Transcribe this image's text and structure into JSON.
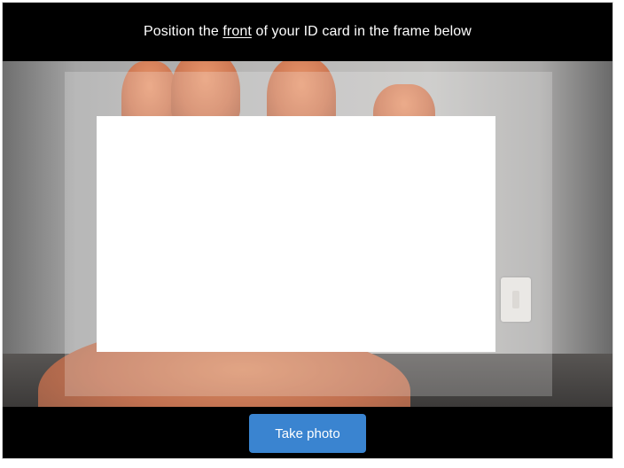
{
  "header": {
    "instruction_prefix": "Position the ",
    "instruction_emphasis": "front",
    "instruction_suffix": " of your ID card in the frame below"
  },
  "footer": {
    "take_photo_label": "Take photo"
  },
  "colors": {
    "background": "#000000",
    "button_accent": "#3a84d0",
    "text": "#ffffff",
    "card_frame": "#ffffff"
  }
}
